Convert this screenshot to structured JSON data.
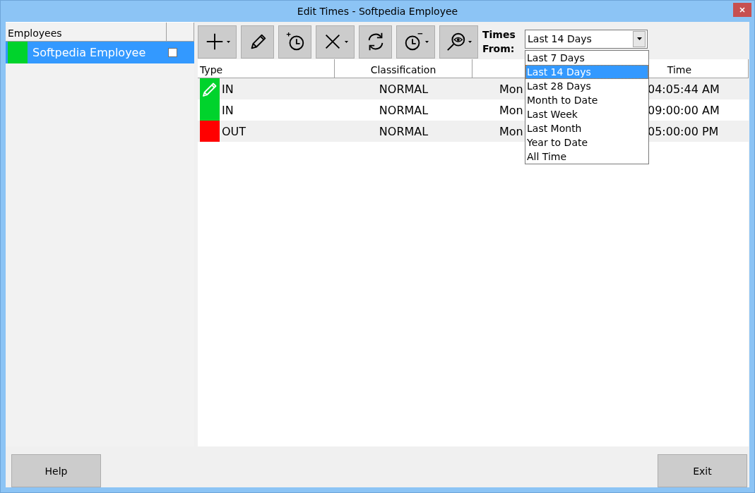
{
  "window": {
    "title": "Edit Times - Softpedia Employee"
  },
  "employees": {
    "header": "Employees",
    "items": [
      {
        "name": "Softpedia Employee",
        "color": "#00d32c",
        "checked": false,
        "selected": true
      }
    ]
  },
  "toolbar": [
    {
      "kind": "add",
      "dropdown": true
    },
    {
      "kind": "edit",
      "dropdown": false
    },
    {
      "kind": "add-time",
      "dropdown": false
    },
    {
      "kind": "delete",
      "dropdown": true
    },
    {
      "kind": "refresh",
      "dropdown": false
    },
    {
      "kind": "remove-time",
      "dropdown": true
    },
    {
      "kind": "view",
      "dropdown": true
    }
  ],
  "times_from": {
    "label": "Times From:",
    "value": "Last 14 Days",
    "expanded": true,
    "options": [
      {
        "label": "Last 7 Days",
        "selected": false
      },
      {
        "label": "Last 14 Days",
        "selected": true
      },
      {
        "label": "Last 28 Days",
        "selected": false
      },
      {
        "label": "Month to Date",
        "selected": false
      },
      {
        "label": "Last Week",
        "selected": false
      },
      {
        "label": "Last Month",
        "selected": false
      },
      {
        "label": "Year to Date",
        "selected": false
      },
      {
        "label": "All Time",
        "selected": false
      }
    ]
  },
  "table": {
    "columns": [
      "Type",
      "Classification",
      "Time"
    ],
    "rows": [
      {
        "type": "IN",
        "color": "#00d32c",
        "editing": true,
        "classification": "NORMAL",
        "column_3": "Mon",
        "time": "04:05:44 AM"
      },
      {
        "type": "IN",
        "color": "#00d32c",
        "editing": false,
        "classification": "NORMAL",
        "column_3": "Mon",
        "time": "09:00:00 AM"
      },
      {
        "type": "OUT",
        "color": "#ff0000",
        "editing": false,
        "classification": "NORMAL",
        "column_3": "Mon",
        "time": "05:00:00 PM"
      }
    ]
  },
  "buttons": [
    {
      "label": "Help"
    },
    {
      "label": "Exit"
    }
  ]
}
